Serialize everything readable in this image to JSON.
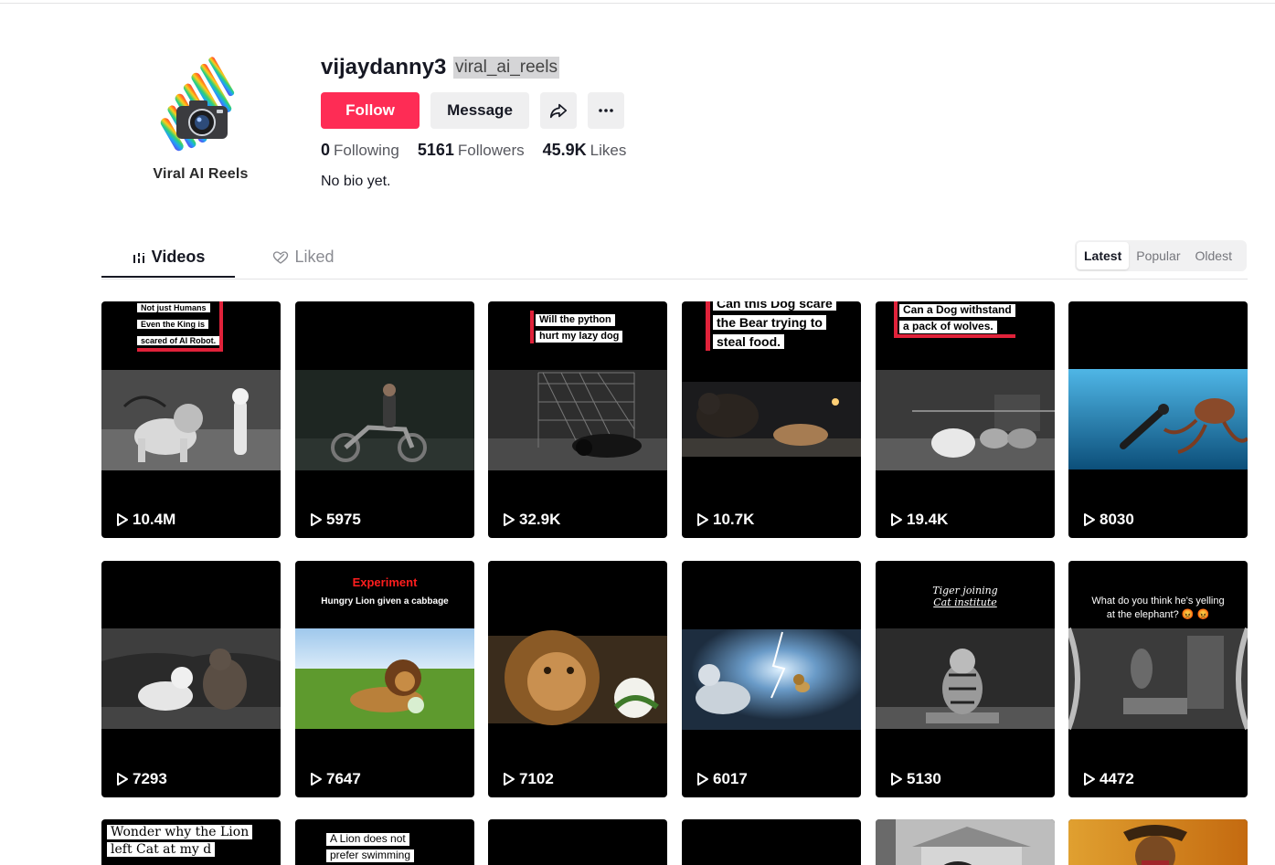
{
  "profile": {
    "avatar_caption": "Viral AI Reels",
    "username": "vijaydanny3",
    "handle": "viral_ai_reels",
    "follow_label": "Follow",
    "message_label": "Message",
    "following_count": "0",
    "following_label": "Following",
    "followers_count": "5161",
    "followers_label": "Followers",
    "likes_count": "45.9K",
    "likes_label": "Likes",
    "bio": "No bio yet."
  },
  "tabs": {
    "videos": "Videos",
    "liked": "Liked"
  },
  "sort": {
    "latest": "Latest",
    "popular": "Popular",
    "oldest": "Oldest"
  },
  "videos": [
    {
      "views": "10.4M",
      "caption": [
        "Not just Humans",
        "Even the King is",
        "scared of AI Robot."
      ]
    },
    {
      "views": "5975",
      "caption": []
    },
    {
      "views": "32.9K",
      "caption": [
        "Will the python",
        "hurt my lazy dog"
      ]
    },
    {
      "views": "10.7K",
      "caption": [
        "Can this Dog scare",
        "the Bear trying to",
        "steal food."
      ]
    },
    {
      "views": "19.4K",
      "caption": [
        "Can a Dog withstand",
        "a pack of wolves."
      ]
    },
    {
      "views": "8030",
      "caption": []
    },
    {
      "views": "7293",
      "caption": []
    },
    {
      "views": "7647",
      "caption": [
        "Experiment",
        "Hungry Lion given a cabbage"
      ]
    },
    {
      "views": "7102",
      "caption": []
    },
    {
      "views": "6017",
      "caption": []
    },
    {
      "views": "5130",
      "caption": [
        "Tiger joining",
        "Cat institute"
      ]
    },
    {
      "views": "4472",
      "caption": [
        "What do you think he's yelling",
        "at the elephant? 😡 😡"
      ]
    },
    {
      "views": "",
      "caption": [
        "Wonder why the Lion",
        "left Cat at my d"
      ]
    },
    {
      "views": "",
      "caption": [
        "A Lion does not",
        "prefer swimming"
      ]
    },
    {
      "views": "",
      "caption": []
    },
    {
      "views": "",
      "caption": []
    },
    {
      "views": "",
      "caption": []
    },
    {
      "views": "",
      "caption": []
    }
  ],
  "colors": {
    "brand_red": "#fe2c55",
    "button_gray": "#efeff0",
    "text_primary": "#161823",
    "text_secondary": "#57585f"
  }
}
